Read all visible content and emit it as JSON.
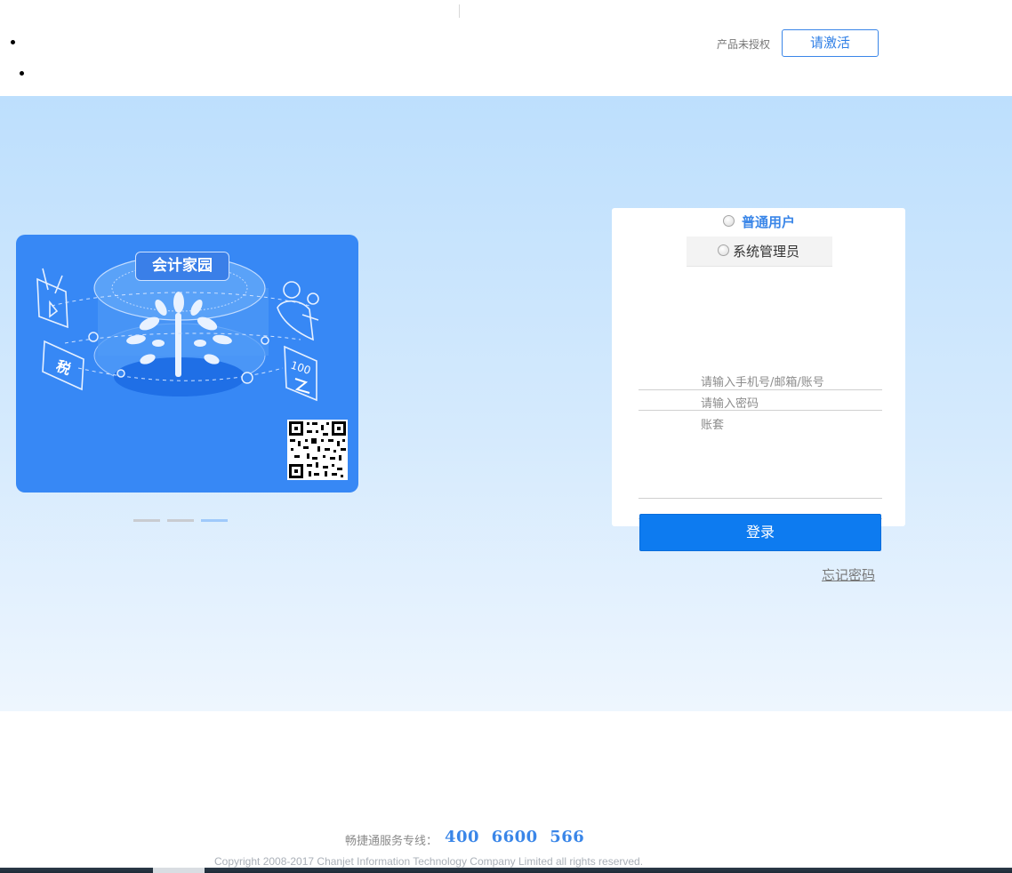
{
  "header": {
    "unauthorized_text": "产品未授权",
    "activate_label": "请激活"
  },
  "banner": {
    "title": "会计家园",
    "tax_glyph": "税",
    "score_glyph": "100"
  },
  "carousel": {
    "count": 3,
    "active_index": 2
  },
  "login": {
    "roles": [
      {
        "label": "普通用户"
      },
      {
        "label": "系统管理员"
      }
    ],
    "fields": {
      "account_placeholder": "请输入手机号/邮箱/账号",
      "password_placeholder": "请输入密码",
      "book_placeholder": "账套"
    },
    "submit_label": "登录",
    "forgot_label": "忘记密码"
  },
  "footer": {
    "hotline_label": "畅捷通服务专线：",
    "hotline_number": "400  6600  566",
    "copyright": "Copyright 2008-2017 Chanjet Information Technology Company Limited all rights reserved."
  },
  "colors": {
    "accent": "#3a86e8",
    "button": "#0d7bf0",
    "banner": "#3788f5"
  }
}
